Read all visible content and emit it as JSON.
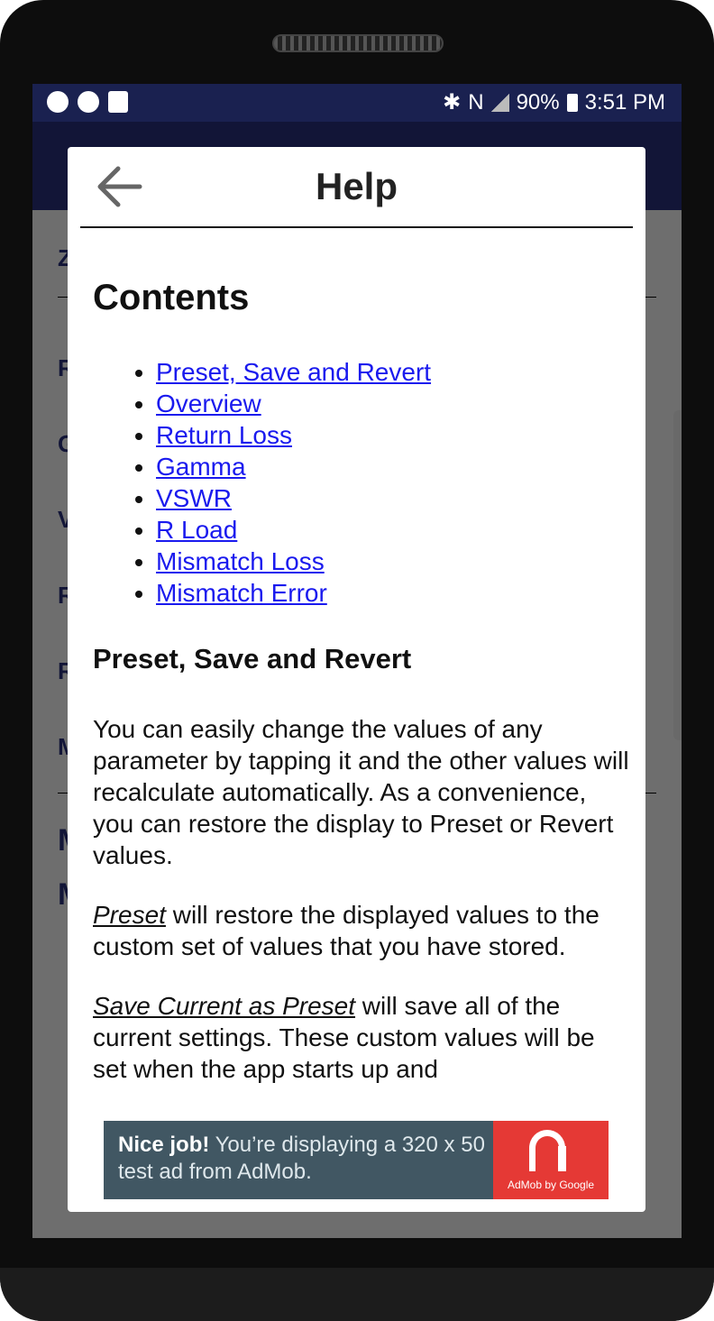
{
  "status_bar": {
    "battery": "90%",
    "time": "3:51 PM"
  },
  "background": {
    "letters": [
      "Z",
      "R",
      "G",
      "V",
      "R",
      "R",
      "M",
      "M",
      "M"
    ]
  },
  "dialog": {
    "title": "Help",
    "contents_heading": "Contents",
    "toc": [
      "Preset, Save and Revert",
      "Overview",
      "Return Loss",
      "Gamma",
      "VSWR",
      "R Load",
      "Mismatch Loss",
      "Mismatch Error"
    ],
    "section_heading": "Preset, Save and Revert",
    "paragraph1": "You can easily change the values of any parameter by tapping it and the other values will recalculate automatically. As a convenience, you can restore the display to Preset or Revert values.",
    "paragraph2_term": "Preset",
    "paragraph2_rest": " will restore the displayed values to the custom set of values that you have stored.",
    "paragraph3_term": "Save Current as Preset",
    "paragraph3_rest": " will save all of the current settings. These custom values will be set when the app starts up and"
  },
  "ad": {
    "headline": "Nice job!",
    "text": " You’re displaying a 320 x 50 test ad from AdMob.",
    "brand": "AdMob by Google"
  }
}
